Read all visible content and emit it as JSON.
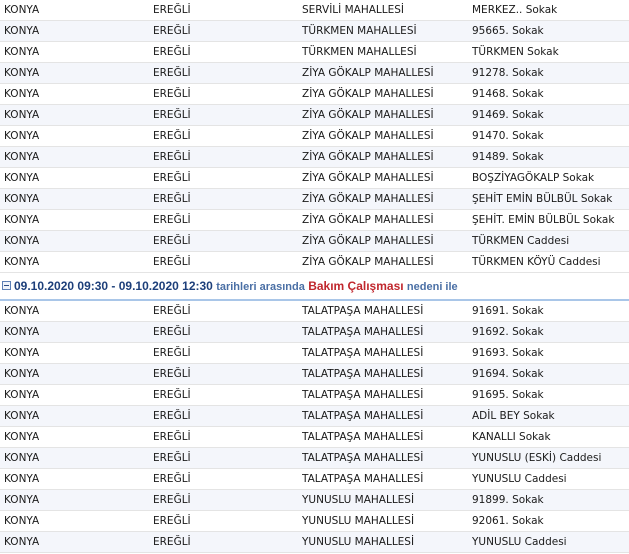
{
  "rows_top": [
    [
      "KONYA",
      "EREĞLİ",
      "SERVİLİ MAHALLESİ",
      "MERKEZ.. Sokak"
    ],
    [
      "KONYA",
      "EREĞLİ",
      "TÜRKMEN MAHALLESİ",
      "95665. Sokak"
    ],
    [
      "KONYA",
      "EREĞLİ",
      "TÜRKMEN MAHALLESİ",
      "TÜRKMEN Sokak"
    ],
    [
      "KONYA",
      "EREĞLİ",
      "ZİYA GÖKALP MAHALLESİ",
      "91278. Sokak"
    ],
    [
      "KONYA",
      "EREĞLİ",
      "ZİYA GÖKALP MAHALLESİ",
      "91468. Sokak"
    ],
    [
      "KONYA",
      "EREĞLİ",
      "ZİYA GÖKALP MAHALLESİ",
      "91469. Sokak"
    ],
    [
      "KONYA",
      "EREĞLİ",
      "ZİYA GÖKALP MAHALLESİ",
      "91470. Sokak"
    ],
    [
      "KONYA",
      "EREĞLİ",
      "ZİYA GÖKALP MAHALLESİ",
      "91489. Sokak"
    ],
    [
      "KONYA",
      "EREĞLİ",
      "ZİYA GÖKALP MAHALLESİ",
      "BOŞZİYAGÖKALP Sokak"
    ],
    [
      "KONYA",
      "EREĞLİ",
      "ZİYA GÖKALP MAHALLESİ",
      "ŞEHİT EMİN BÜLBÜL Sokak"
    ],
    [
      "KONYA",
      "EREĞLİ",
      "ZİYA GÖKALP MAHALLESİ",
      "ŞEHİT. EMİN BÜLBÜL Sokak"
    ],
    [
      "KONYA",
      "EREĞLİ",
      "ZİYA GÖKALP MAHALLESİ",
      "TÜRKMEN Caddesi"
    ],
    [
      "KONYA",
      "EREĞLİ",
      "ZİYA GÖKALP MAHALLESİ",
      "TÜRKMEN KÖYÜ Caddesi"
    ]
  ],
  "group": {
    "date_range": "09.10.2020 09:30 - 09.10.2020 12:30",
    "between_text": "tarihleri arasında",
    "reason": "Bakım Çalışması",
    "reason_suffix": "nedeni ile"
  },
  "rows_bottom": [
    [
      "KONYA",
      "EREĞLİ",
      "TALATPAŞA MAHALLESİ",
      "91691. Sokak"
    ],
    [
      "KONYA",
      "EREĞLİ",
      "TALATPAŞA MAHALLESİ",
      "91692. Sokak"
    ],
    [
      "KONYA",
      "EREĞLİ",
      "TALATPAŞA MAHALLESİ",
      "91693. Sokak"
    ],
    [
      "KONYA",
      "EREĞLİ",
      "TALATPAŞA MAHALLESİ",
      "91694. Sokak"
    ],
    [
      "KONYA",
      "EREĞLİ",
      "TALATPAŞA MAHALLESİ",
      "91695. Sokak"
    ],
    [
      "KONYA",
      "EREĞLİ",
      "TALATPAŞA MAHALLESİ",
      "ADİL BEY Sokak"
    ],
    [
      "KONYA",
      "EREĞLİ",
      "TALATPAŞA MAHALLESİ",
      "KANALLI Sokak"
    ],
    [
      "KONYA",
      "EREĞLİ",
      "TALATPAŞA MAHALLESİ",
      "YUNUSLU (ESKİ) Caddesi"
    ],
    [
      "KONYA",
      "EREĞLİ",
      "TALATPAŞA MAHALLESİ",
      "YUNUSLU Caddesi"
    ],
    [
      "KONYA",
      "EREĞLİ",
      "YUNUSLU MAHALLESİ",
      "91899. Sokak"
    ],
    [
      "KONYA",
      "EREĞLİ",
      "YUNUSLU MAHALLESİ",
      "92061. Sokak"
    ],
    [
      "KONYA",
      "EREĞLİ",
      "YUNUSLU MAHALLESİ",
      "YUNUSLU Caddesi"
    ]
  ]
}
